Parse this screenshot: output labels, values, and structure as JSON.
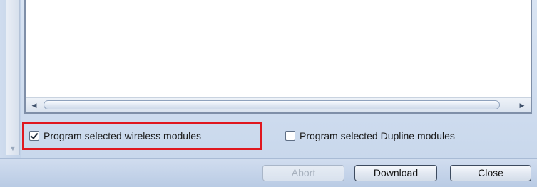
{
  "options": {
    "wireless": {
      "label": "Program selected wireless modules",
      "checked": true
    },
    "dupline": {
      "label": "Program selected Dupline modules",
      "checked": false
    }
  },
  "buttons": {
    "abort": {
      "label": "Abort",
      "enabled": false
    },
    "download": {
      "label": "Download",
      "enabled": true
    },
    "close": {
      "label": "Close",
      "enabled": true
    }
  },
  "icons": {
    "scroll_left": "chevron-left-icon",
    "scroll_right": "chevron-right-icon",
    "scroll_down": "chevron-down-icon"
  },
  "colors": {
    "highlight_border": "#e0171f",
    "panel_background": "#d9e4f3"
  }
}
